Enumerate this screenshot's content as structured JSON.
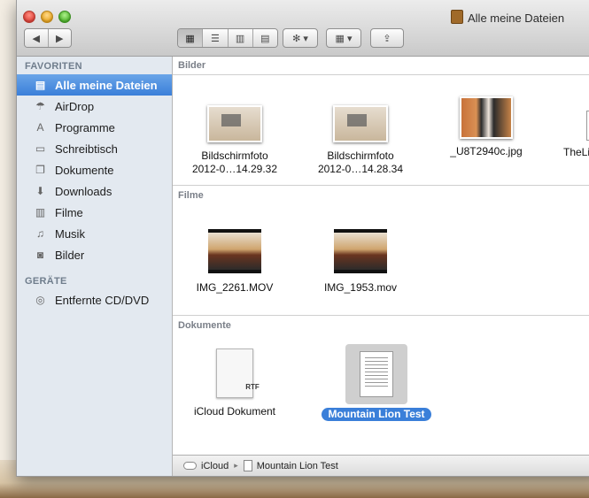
{
  "window": {
    "title": "Alle meine Dateien"
  },
  "toolbar": {
    "back_icon": "◀",
    "forward_icon": "▶",
    "view_icons": [
      "▦",
      "☰",
      "▥",
      "▤"
    ],
    "action_icon": "✻ ▾",
    "arrange_icon": "▦ ▾",
    "share_icon": "⇪"
  },
  "sidebar": {
    "favorites_heading": "FAVORITEN",
    "devices_heading": "GERÄTE",
    "items": [
      {
        "label": "Alle meine Dateien",
        "icon": "▤"
      },
      {
        "label": "AirDrop",
        "icon": "☂"
      },
      {
        "label": "Programme",
        "icon": "A"
      },
      {
        "label": "Schreibtisch",
        "icon": "▭"
      },
      {
        "label": "Dokumente",
        "icon": "❐"
      },
      {
        "label": "Downloads",
        "icon": "⬇"
      },
      {
        "label": "Filme",
        "icon": "▥"
      },
      {
        "label": "Musik",
        "icon": "♫"
      },
      {
        "label": "Bilder",
        "icon": "◙"
      }
    ],
    "devices": [
      {
        "label": "Entfernte CD/DVD",
        "icon": "◎"
      }
    ]
  },
  "sections": {
    "bilder": {
      "heading": "Bilder",
      "files": [
        {
          "line1": "Bildschirmfoto",
          "line2": "2012-0…14.29.32"
        },
        {
          "line1": "Bildschirmfoto",
          "line2": "2012-0…14.28.34"
        },
        {
          "line1": "_U8T2940c.jpg",
          "line2": ""
        },
        {
          "line1": "TheLi",
          "line2": ""
        }
      ]
    },
    "filme": {
      "heading": "Filme",
      "files": [
        {
          "line1": "IMG_2261.MOV"
        },
        {
          "line1": "IMG_1953.mov"
        }
      ]
    },
    "dokumente": {
      "heading": "Dokumente",
      "files": [
        {
          "line1": "iCloud Dokument",
          "badge": "RTF"
        },
        {
          "line1": "Mountain Lion Test"
        }
      ]
    }
  },
  "pathbar": {
    "root": "iCloud",
    "separator": "▸",
    "item": "Mountain Lion Test"
  }
}
